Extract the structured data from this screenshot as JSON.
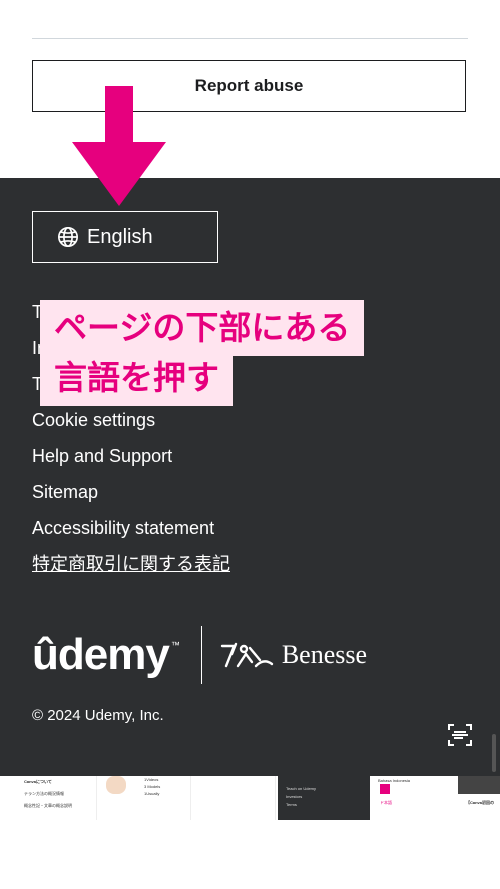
{
  "top": {
    "report_abuse_label": "Report abuse"
  },
  "footer": {
    "language_button": "English",
    "links": [
      {
        "label": "Teach on Udemy",
        "underline": false
      },
      {
        "label": "Investors",
        "underline": false
      },
      {
        "label": "Terms",
        "underline": false
      },
      {
        "label": "Cookie settings",
        "underline": false
      },
      {
        "label": "Help and Support",
        "underline": false
      },
      {
        "label": "Sitemap",
        "underline": false
      },
      {
        "label": "Accessibility statement",
        "underline": false
      },
      {
        "label": "特定商取引に関する表記",
        "underline": true
      }
    ],
    "udemy_logo": "ûdemy",
    "trademark": "™",
    "benesse_logo": "Benesse",
    "copyright": "© 2024 Udemy, Inc."
  },
  "annotation": {
    "line1": "ページの下部にある",
    "line2": "言語を押す",
    "color": "#e6007e",
    "bg": "#ffe4ef"
  },
  "thumbs": {
    "t1_title": "Canvaについて",
    "t1_item1": "テラン方法の概況情報",
    "t1_item2": "概念性記・文章の概念説明",
    "t2_line1": "1Videos",
    "t2_line2": "3 Models",
    "t2_line3": "1Usually",
    "t4_line1": "Teach on Udemy",
    "t4_line2": "Investors",
    "t4_line3": "Terms",
    "t5_title": "Bahasa Indonesia",
    "t5_sub": "ド本語",
    "t6_title": "【Canva初回の"
  },
  "icons": [
    "globe-icon",
    "scan-icon",
    "arrow-down-icon"
  ]
}
